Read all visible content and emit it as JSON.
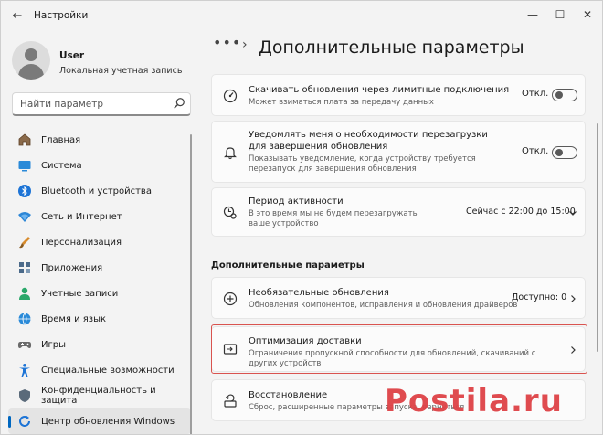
{
  "window": {
    "title": "Настройки",
    "controls": {
      "back": "←",
      "minimize": "—",
      "maximize": "☐",
      "close": "✕"
    }
  },
  "profile": {
    "name": "User",
    "subtitle": "Локальная учетная запись"
  },
  "search": {
    "placeholder": "Найти параметр"
  },
  "sidebar": {
    "items": [
      {
        "label": "Главная",
        "icon": "home-icon"
      },
      {
        "label": "Система",
        "icon": "system-icon"
      },
      {
        "label": "Bluetooth и устройства",
        "icon": "bluetooth-icon"
      },
      {
        "label": "Сеть и Интернет",
        "icon": "network-icon"
      },
      {
        "label": "Персонализация",
        "icon": "brush-icon"
      },
      {
        "label": "Приложения",
        "icon": "apps-icon"
      },
      {
        "label": "Учетные записи",
        "icon": "accounts-icon"
      },
      {
        "label": "Время и язык",
        "icon": "globe-icon"
      },
      {
        "label": "Игры",
        "icon": "gamepad-icon"
      },
      {
        "label": "Специальные возможности",
        "icon": "accessibility-icon"
      },
      {
        "label": "Конфиденциальность и защита",
        "icon": "shield-icon"
      },
      {
        "label": "Центр обновления Windows",
        "icon": "update-icon",
        "active": true
      }
    ]
  },
  "main": {
    "breadcrumb_dots": "•••",
    "breadcrumb_sep": "›",
    "title": "Дополнительные параметры",
    "cards": [
      {
        "title": "Скачивать обновления через лимитные подключения",
        "desc": "Может взиматься плата за передачу данных",
        "right": "Откл."
      },
      {
        "title": "Уведомлять меня о необходимости перезагрузки для завершения обновления",
        "desc": "Показывать уведомление, когда устройству требуется перезапуск для завершения обновления",
        "right": "Откл."
      },
      {
        "title": "Период активности",
        "desc": "В это время мы не будем перезагружать ваше устройство",
        "right": "Сейчас с 22:00 до 15:00"
      }
    ],
    "section_heading": "Дополнительные параметры",
    "links": [
      {
        "title": "Необязательные обновления",
        "desc": "Обновления компонентов, исправления и обновления драйверов",
        "right": "Доступно: 0"
      },
      {
        "title": "Оптимизация доставки",
        "desc": "Ограничения пропускной способности для обновлений, скачиваний с других устройств"
      },
      {
        "title": "Восстановление",
        "desc": "Сброс, расширенные параметры запуска, вернуться"
      }
    ]
  },
  "watermark": "Postila.ru",
  "colors": {
    "accent": "#0067c0",
    "highlight": "#d9534f",
    "watermark": "#dc373c"
  }
}
